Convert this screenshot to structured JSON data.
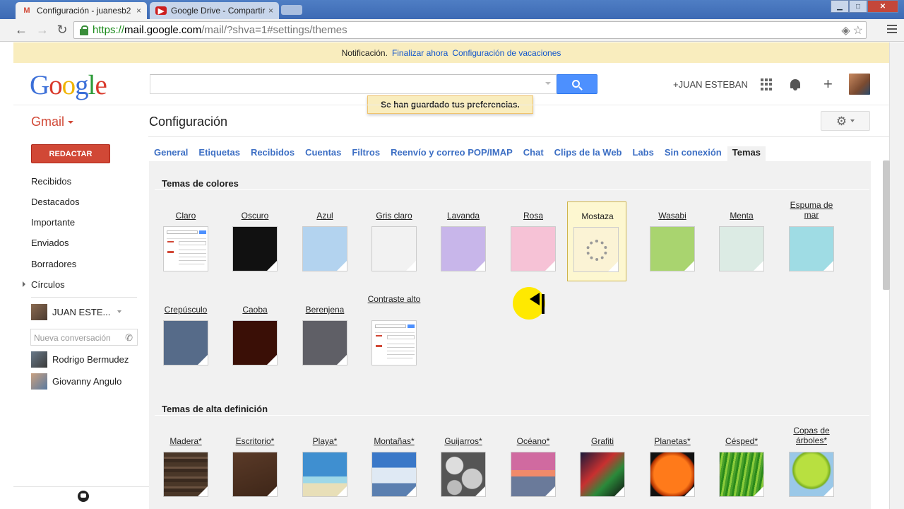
{
  "browser": {
    "tabs": [
      {
        "title": "Configuración - juanesb2",
        "icon": "gmail-icon",
        "close": "×"
      },
      {
        "title": "Google Drive - Compartir",
        "icon": "youtube-icon",
        "close": "×"
      }
    ],
    "address": {
      "scheme": "https://",
      "host": "mail.google.com",
      "path": "/mail/?shva=1#settings/themes"
    },
    "window_buttons": {
      "minimize": "▁",
      "maximize": "□",
      "close": "✕"
    }
  },
  "notification": {
    "text": "Notificación.",
    "finish_now": "Finalizar ahora",
    "vacation": "Configuración de vacaciones"
  },
  "header": {
    "logo": {
      "G": "G",
      "o1": "o",
      "o2": "o",
      "g": "g",
      "l": "l",
      "e": "e"
    },
    "search_placeholder": "",
    "user_name": "+JUAN ESTEBAN",
    "plus": "+",
    "toast": "Se han guardado tus preferencias."
  },
  "subheader": {
    "app_label": "Gmail",
    "page_title": "Configuración"
  },
  "nav": {
    "compose": "REDACTAR",
    "items": [
      "Recibidos",
      "Destacados",
      "Importante",
      "Enviados",
      "Borradores",
      "Círculos"
    ],
    "chat_self": "JUAN ESTE...",
    "chat_search_placeholder": "Nueva conversación",
    "contacts": [
      "Rodrigo Bermudez",
      "Giovanny Angulo"
    ]
  },
  "settings_tabs": [
    "General",
    "Etiquetas",
    "Recibidos",
    "Cuentas",
    "Filtros",
    "Reenvío y correo POP/IMAP",
    "Chat",
    "Clips de la Web",
    "Labs",
    "Sin conexión",
    "Temas"
  ],
  "themes": {
    "color_title": "Temas de colores",
    "color_row1": [
      {
        "name": "Claro",
        "color": "#ffffff",
        "mini": true
      },
      {
        "name": "Oscuro",
        "color": "#111111"
      },
      {
        "name": "Azul",
        "color": "#b3d3ef"
      },
      {
        "name": "Gris claro",
        "color": "#f2f2f2"
      },
      {
        "name": "Lavanda",
        "color": "#c8b6ea"
      },
      {
        "name": "Rosa",
        "color": "#f6c2d6"
      },
      {
        "name": "Mostaza",
        "color": "#fbf3d5",
        "selected": true
      },
      {
        "name": "Wasabi",
        "color": "#a9d46f"
      },
      {
        "name": "Menta",
        "color": "#dcebe4"
      },
      {
        "name": "Espuma de mar",
        "color": "#9fdce4"
      }
    ],
    "color_row2": [
      {
        "name": "Crepúsculo",
        "color": "#566b89"
      },
      {
        "name": "Caoba",
        "color": "#3a0f06"
      },
      {
        "name": "Berenjena",
        "color": "#5f5f66"
      },
      {
        "name": "Contraste alto",
        "color": "#ffffff",
        "mini": true
      }
    ],
    "hd_title": "Temas de alta definición",
    "hd_row": [
      {
        "name": "Madera*",
        "style": "hd-madera"
      },
      {
        "name": "Escritorio*",
        "style": "hd-escritorio"
      },
      {
        "name": "Playa*",
        "style": "hd-playa"
      },
      {
        "name": "Montañas*",
        "style": "hd-montanas"
      },
      {
        "name": "Guijarros*",
        "style": "hd-guijarros"
      },
      {
        "name": "Océano*",
        "style": "hd-oceano"
      },
      {
        "name": "Grafiti",
        "style": "hd-grafiti"
      },
      {
        "name": "Planetas*",
        "style": "hd-planetas"
      },
      {
        "name": "Césped*",
        "style": "hd-cesped"
      },
      {
        "name": "Copas de árboles*",
        "style": "hd-copas"
      }
    ]
  }
}
